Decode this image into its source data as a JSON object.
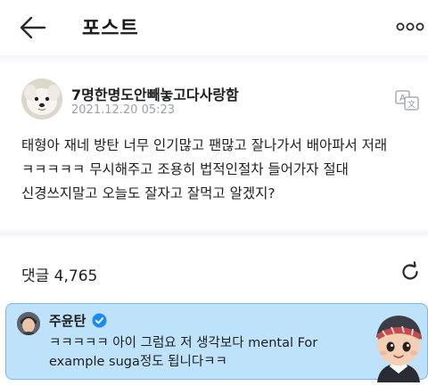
{
  "header": {
    "title": "포스트"
  },
  "post": {
    "author": "7명한명도안빼놓고다사랑함",
    "timestamp": "2021.12.20 05:23",
    "lines": [
      "태형아 재네 방탄 너무 인기많고 팬많고 잘나가서 배아파서 저래",
      "ㅋㅋㅋㅋㅋ 무시해주고 조용히 법적인절차 들어가자 절대",
      "신경쓰지말고 오늘도 잘자고 잘먹고 알겠지?"
    ]
  },
  "comments": {
    "count_label": "댓글 4,765"
  },
  "comment": {
    "author": "주윤탄",
    "lines": [
      "ㅋㅋㅋㅋㅋ 아이 그럼요 저 생각보다 mental For",
      "example suga정도 됩니다ㅋㅋ"
    ]
  },
  "icons": {
    "back": "back-arrow-icon",
    "more": "more-dots-icon",
    "translate": "translate-icon",
    "refresh": "refresh-icon",
    "verified": "verified-badge-icon"
  },
  "colors": {
    "accent": "#1a8cf0",
    "comment_bg": "#bfe2fb",
    "timestamp": "#9aa0a8"
  }
}
